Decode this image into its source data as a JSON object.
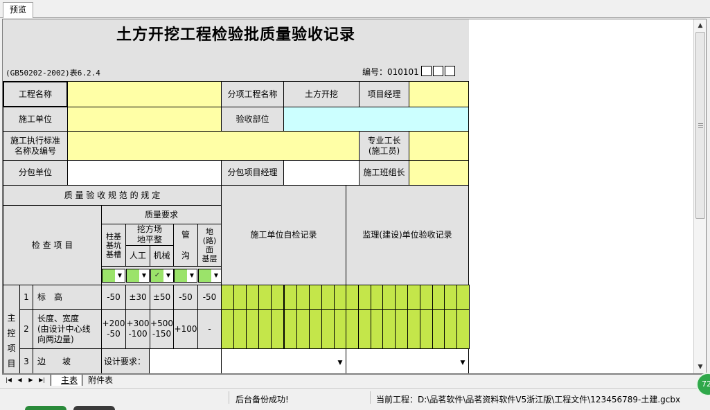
{
  "tab": {
    "label": "预览"
  },
  "form": {
    "title": "土方开挖工程检验批质量验收记录",
    "standard": "(GB50202-2002)表6.2.4",
    "number_label": "编号：010101"
  },
  "header": {
    "project_name": "工程名称",
    "sub_project_name": "分项工程名称",
    "sub_project_value": "土方开挖",
    "project_manager": "项目经理",
    "construction_unit": "施工单位",
    "acceptance_part": "验收部位",
    "standard_label_1": "施工执行标准",
    "standard_label_2": "名称及编号",
    "foreman_1": "专业工长",
    "foreman_2": "(施工员)",
    "subcontractor": "分包单位",
    "sub_manager": "分包项目经理",
    "team_leader": "施工班组长"
  },
  "spec": {
    "regulation": "质 量 验 收 规 范 的 规 定",
    "inspection_items": "检 查 项 目",
    "quality_req": "质量要求",
    "col_pit_1": "柱基",
    "col_pit_2": "基坑",
    "col_pit_3": "基槽",
    "col_site_1": "挖方场",
    "col_site_2": "地平整",
    "col_manual": "人工",
    "col_machine": "机械",
    "col_trench_1": "管",
    "col_trench_2": "沟",
    "col_ground_1": "地",
    "col_ground_2": "(路)",
    "col_ground_3": "面",
    "col_ground_4": "基层",
    "self_check": "施工单位自检记录",
    "supervision": "监理(建设)单位验收记录"
  },
  "rows": {
    "main_1": "主",
    "main_2": "控",
    "main_3": "项",
    "main_4": "目",
    "r1_no": "1",
    "r1_name": "标　高",
    "r1_v": [
      "-50",
      "±30",
      "±50",
      "-50",
      "-50"
    ],
    "r2_no": "2",
    "r2_name_1": "长度、宽度",
    "r2_name_2": "(由设计中心线",
    "r2_name_3": "向两边量)",
    "r2_v1a": "+200",
    "r2_v1b": "-50",
    "r2_v2a": "+300",
    "r2_v2b": "-100",
    "r2_v3a": "+500",
    "r2_v3b": "-150",
    "r2_v4": "+100",
    "r2_v5": "-",
    "r3_no": "3",
    "r3_name": "边　　坡",
    "r3_design": "设计要求："
  },
  "sheet_tabs": {
    "main": "主表",
    "attached": "附件表"
  },
  "status": {
    "backup": "后台备份成功!",
    "project": "当前工程：D:\\品茗软件\\品茗资料软件V5浙江版\\工程文件\\123456789-土建.gcbx"
  },
  "badge": {
    "value": "72"
  },
  "colors": {
    "yellow": "#ffffa6",
    "cyan": "#ccffff",
    "green": "#c4e64a",
    "gray": "#e2e2e2"
  }
}
